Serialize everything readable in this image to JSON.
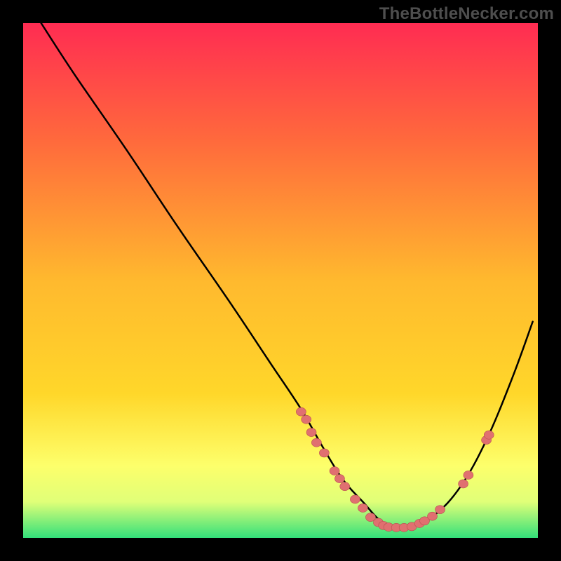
{
  "watermark": "TheBottleNecker.com",
  "chart_data": {
    "type": "line",
    "title": "",
    "xlabel": "",
    "ylabel": "",
    "xlim": [
      0,
      100
    ],
    "ylim": [
      0,
      100
    ],
    "grid": false,
    "legend": false,
    "background_gradient": [
      "#ff2c52",
      "#ffd72a",
      "#33e07a"
    ],
    "series": [
      {
        "name": "curve",
        "x": [
          3.5,
          10,
          20,
          30,
          40,
          48,
          54,
          58,
          62,
          66,
          70,
          75,
          80,
          85,
          90,
          95,
          99
        ],
        "y": [
          100,
          90,
          75.5,
          60.5,
          46,
          34,
          25,
          18,
          11.5,
          7,
          3,
          2,
          4.5,
          10,
          19,
          31,
          42
        ]
      }
    ],
    "markers": [
      {
        "x": 54.0,
        "y": 24.5
      },
      {
        "x": 55.0,
        "y": 23.0
      },
      {
        "x": 56.0,
        "y": 20.5
      },
      {
        "x": 57.0,
        "y": 18.5
      },
      {
        "x": 58.5,
        "y": 16.5
      },
      {
        "x": 60.5,
        "y": 13.0
      },
      {
        "x": 61.5,
        "y": 11.5
      },
      {
        "x": 62.5,
        "y": 10.0
      },
      {
        "x": 64.5,
        "y": 7.5
      },
      {
        "x": 66.0,
        "y": 5.8
      },
      {
        "x": 67.5,
        "y": 4.0
      },
      {
        "x": 69.0,
        "y": 3.0
      },
      {
        "x": 70.0,
        "y": 2.4
      },
      {
        "x": 71.0,
        "y": 2.1
      },
      {
        "x": 72.5,
        "y": 2.0
      },
      {
        "x": 74.0,
        "y": 2.0
      },
      {
        "x": 75.5,
        "y": 2.2
      },
      {
        "x": 77.0,
        "y": 2.8
      },
      {
        "x": 78.0,
        "y": 3.3
      },
      {
        "x": 79.5,
        "y": 4.2
      },
      {
        "x": 81.0,
        "y": 5.5
      },
      {
        "x": 85.5,
        "y": 10.5
      },
      {
        "x": 86.5,
        "y": 12.2
      },
      {
        "x": 90.0,
        "y": 19.0
      },
      {
        "x": 90.5,
        "y": 20.0
      }
    ]
  }
}
